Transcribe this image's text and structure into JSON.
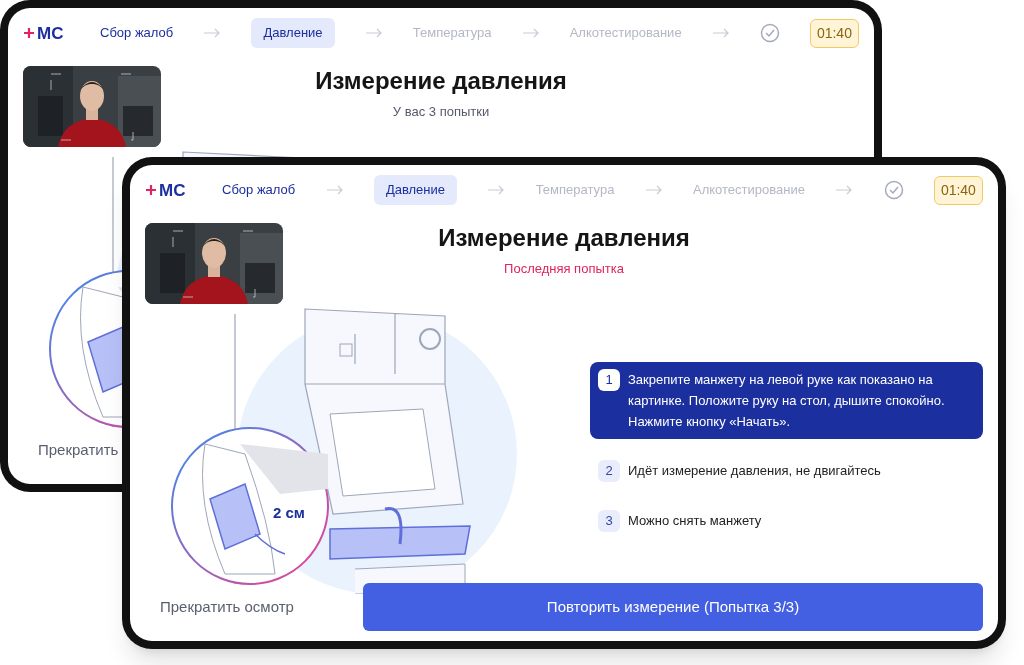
{
  "screens": [
    {
      "header": {
        "logo": "МС",
        "steps": [
          {
            "label": "Сбор жалоб",
            "done": true,
            "selected": false
          },
          {
            "label": "Давление",
            "done": false,
            "selected": true
          },
          {
            "label": "Температура",
            "done": false,
            "selected": false
          },
          {
            "label": "Алкотестирование",
            "done": false,
            "selected": false
          }
        ],
        "timer": "01:40"
      },
      "camera": {
        "kind": "picture"
      },
      "title": "Измерение давления",
      "subtitle": {
        "text": "У вас 3 попытки",
        "alert": false
      },
      "stop_button": "Прекратить"
    },
    {
      "header": {
        "logo": "МС",
        "steps": [
          {
            "label": "Сбор жалоб",
            "done": true,
            "selected": false
          },
          {
            "label": "Давление",
            "done": false,
            "selected": true
          },
          {
            "label": "Температура",
            "done": false,
            "selected": false
          },
          {
            "label": "Алкотестирование",
            "done": false,
            "selected": false
          }
        ],
        "timer": "01:40"
      },
      "camera": {
        "kind": "picture"
      },
      "title": "Измерение давления",
      "subtitle": {
        "text": "Последняя попытка",
        "alert": true
      },
      "illustration_label": "2 см",
      "instructions": [
        {
          "number": "1",
          "text": "Закрепите манжету на левой руке как показано на картинке. Положите руку на стол, дышите спокойно. Нажмите кнопку «Начать».",
          "selected": true
        },
        {
          "number": "2",
          "text": "Идёт измерение давления, не двигайтесь",
          "selected": false
        },
        {
          "number": "3",
          "text": "Можно снять манжету",
          "selected": false
        }
      ],
      "stop_button": "Прекратить осмотр",
      "retry_button": "Повторить измерение (Попытка 3/3)"
    }
  ]
}
